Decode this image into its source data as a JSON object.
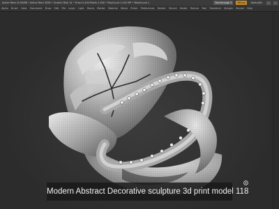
{
  "app": {
    "status_text": "Active Mem 2k RAM8 • Active Mem 3456 • Scratch Disk 14 • Timer 0.444 Points 2.000 • PolyCount 1.442 MP • MeshCount 1",
    "see_through_label": "See-through 0",
    "menus_label": "Menus",
    "default_label": "DefaultZs"
  },
  "menubar": {
    "items": [
      "Alpha",
      "Brush",
      "Color",
      "Document",
      "Draw",
      "Edit",
      "File",
      "Layer",
      "Light",
      "Macro",
      "Marker",
      "Material",
      "Movie",
      "Picker",
      "Preferences",
      "Render",
      "Stencil",
      "Stroke",
      "Texture",
      "Tool",
      "Transform",
      "Zplugin",
      "Zscript",
      "Help"
    ]
  },
  "caption": {
    "text": "Modern Abstract Decorative sculpture 3d print model 118"
  },
  "colors": {
    "menus_accent": "#c98a1f",
    "background": "#2a2a2a"
  },
  "icons": {
    "settings": "gear-icon"
  }
}
